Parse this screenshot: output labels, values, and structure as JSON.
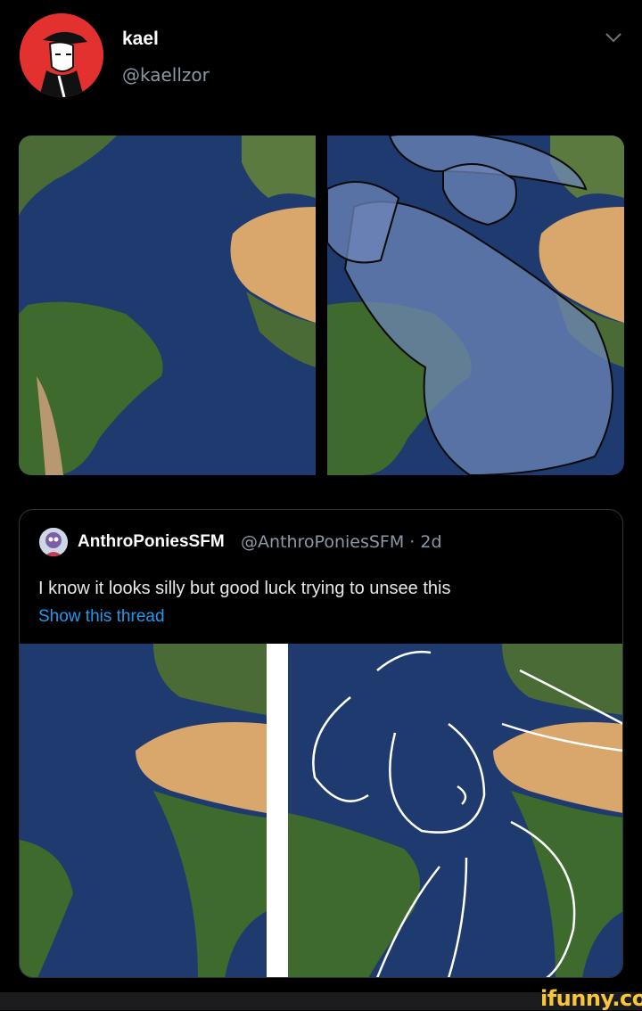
{
  "tweet": {
    "display_name": "kael",
    "handle": "@kaellzor",
    "menu_icon": "chevron-down-icon"
  },
  "quoted_tweet": {
    "display_name": "AnthroPoniesSFM",
    "handle_time": "@AnthroPoniesSFM · 2d",
    "text": "I know it looks silly but good luck trying to unsee this",
    "link_label": "Show this thread"
  },
  "watermark": "ifunny.co",
  "colors": {
    "background": "#000000",
    "avatar_bg": "#e2312f",
    "link": "#1d9bf0",
    "ocean": "#1e3a6e",
    "land_green": "#4a6b35",
    "desert": "#d9a66b",
    "watermark": "#f7c63b"
  }
}
